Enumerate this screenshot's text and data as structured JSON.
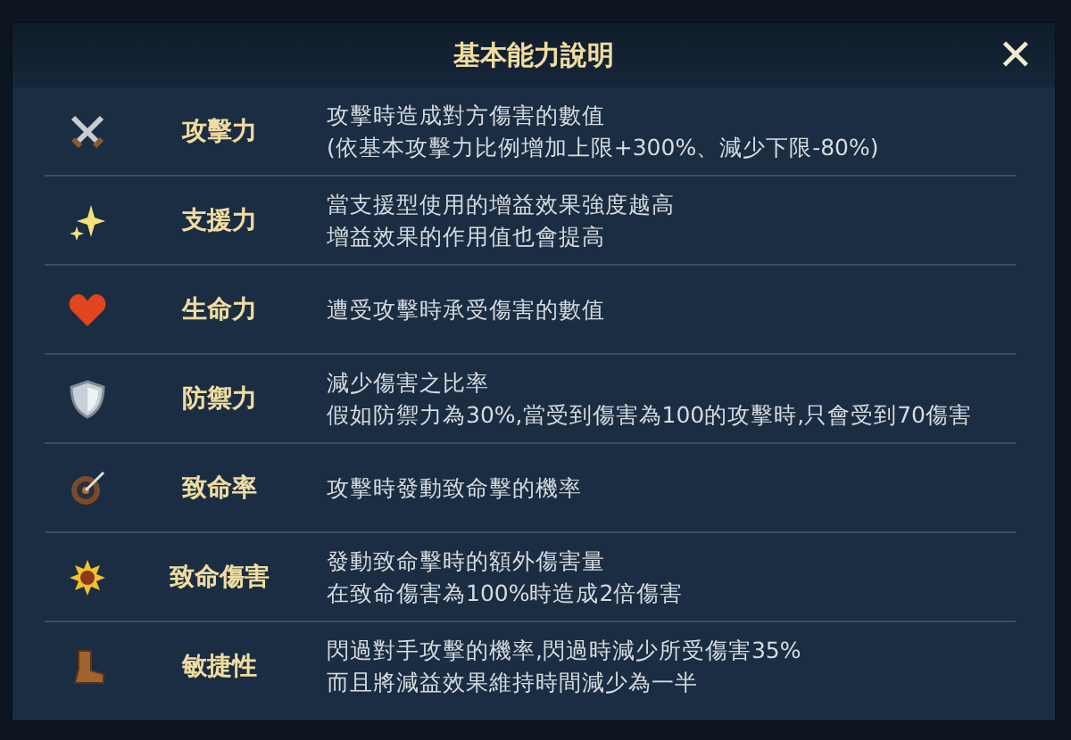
{
  "dialog": {
    "title": "基本能力說明",
    "close": "✕"
  },
  "rows": [
    {
      "label": "攻擊力",
      "lines": [
        "攻擊時造成對方傷害的數值",
        "(依基本攻擊力比例增加上限+300%、減少下限-80%)"
      ]
    },
    {
      "label": "支援力",
      "lines": [
        "當支援型使用的增益效果強度越高",
        "增益效果的作用值也會提高"
      ]
    },
    {
      "label": "生命力",
      "lines": [
        "遭受攻擊時承受傷害的數值"
      ]
    },
    {
      "label": "防禦力",
      "lines": [
        "減少傷害之比率",
        "假如防禦力為30%,當受到傷害為100的攻擊時,只會受到70傷害"
      ]
    },
    {
      "label": "致命率",
      "lines": [
        "攻擊時發動致命擊的機率"
      ]
    },
    {
      "label": "致命傷害",
      "lines": [
        "發動致命擊時的額外傷害量",
        "在致命傷害為100%時造成2倍傷害"
      ]
    },
    {
      "label": "敏捷性",
      "lines": [
        "閃過對手攻擊的機率,閃過時減少所受傷害35%",
        "而且將減益效果維持時間減少為一半"
      ]
    }
  ]
}
